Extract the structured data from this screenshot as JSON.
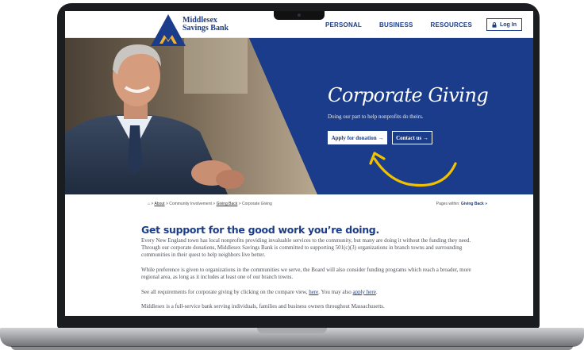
{
  "colors": {
    "brand": "#1a3c8a",
    "annotation": "#f2c200",
    "laptop": "#1b1c1f"
  },
  "brand": {
    "line1": "Middlesex",
    "line2": "Savings Bank",
    "mark": "·"
  },
  "nav": {
    "items": [
      "PERSONAL",
      "BUSINESS",
      "RESOURCES"
    ],
    "login": "Log In",
    "login_icon": "lock-icon"
  },
  "hero": {
    "title": "Corporate Giving",
    "subtitle": "Doing our part to help nonprofits do theirs.",
    "apply": "Apply for donation →",
    "contact": "Contact us →"
  },
  "breadcrumb": {
    "home_icon": "home-icon",
    "sep": ">",
    "items": [
      "About",
      "Community Involvement",
      "Giving Back",
      "Corporate Giving"
    ]
  },
  "within": {
    "label": "Pages within:",
    "link": "Giving Back »"
  },
  "content": {
    "heading": "Get support for the good work you’re doing.",
    "p1": "Every New England town has local nonprofits providing invaluable services to the community, but many are doing it without the funding they need. Through our corporate donations, Middlesex Savings Bank is committed to supporting 501(c)(3) organizations in branch towns and surrounding communities in their quest to help neighbors live better.",
    "p2": "While preference is given to organizations in the communities we serve, the Board will also consider funding programs which reach a broader, more regional area, as long as it includes at least one of our branch towns.",
    "p3_before": "See all requirements for corporate giving by clicking on the compare view, ",
    "p3_link1": "here",
    "p3_middle": ". You may also ",
    "p3_link2": "apply here",
    "p3_after": ".",
    "p4": "Middlesex is a full-service bank serving individuals, families and business owners throughout Massachusetts."
  }
}
